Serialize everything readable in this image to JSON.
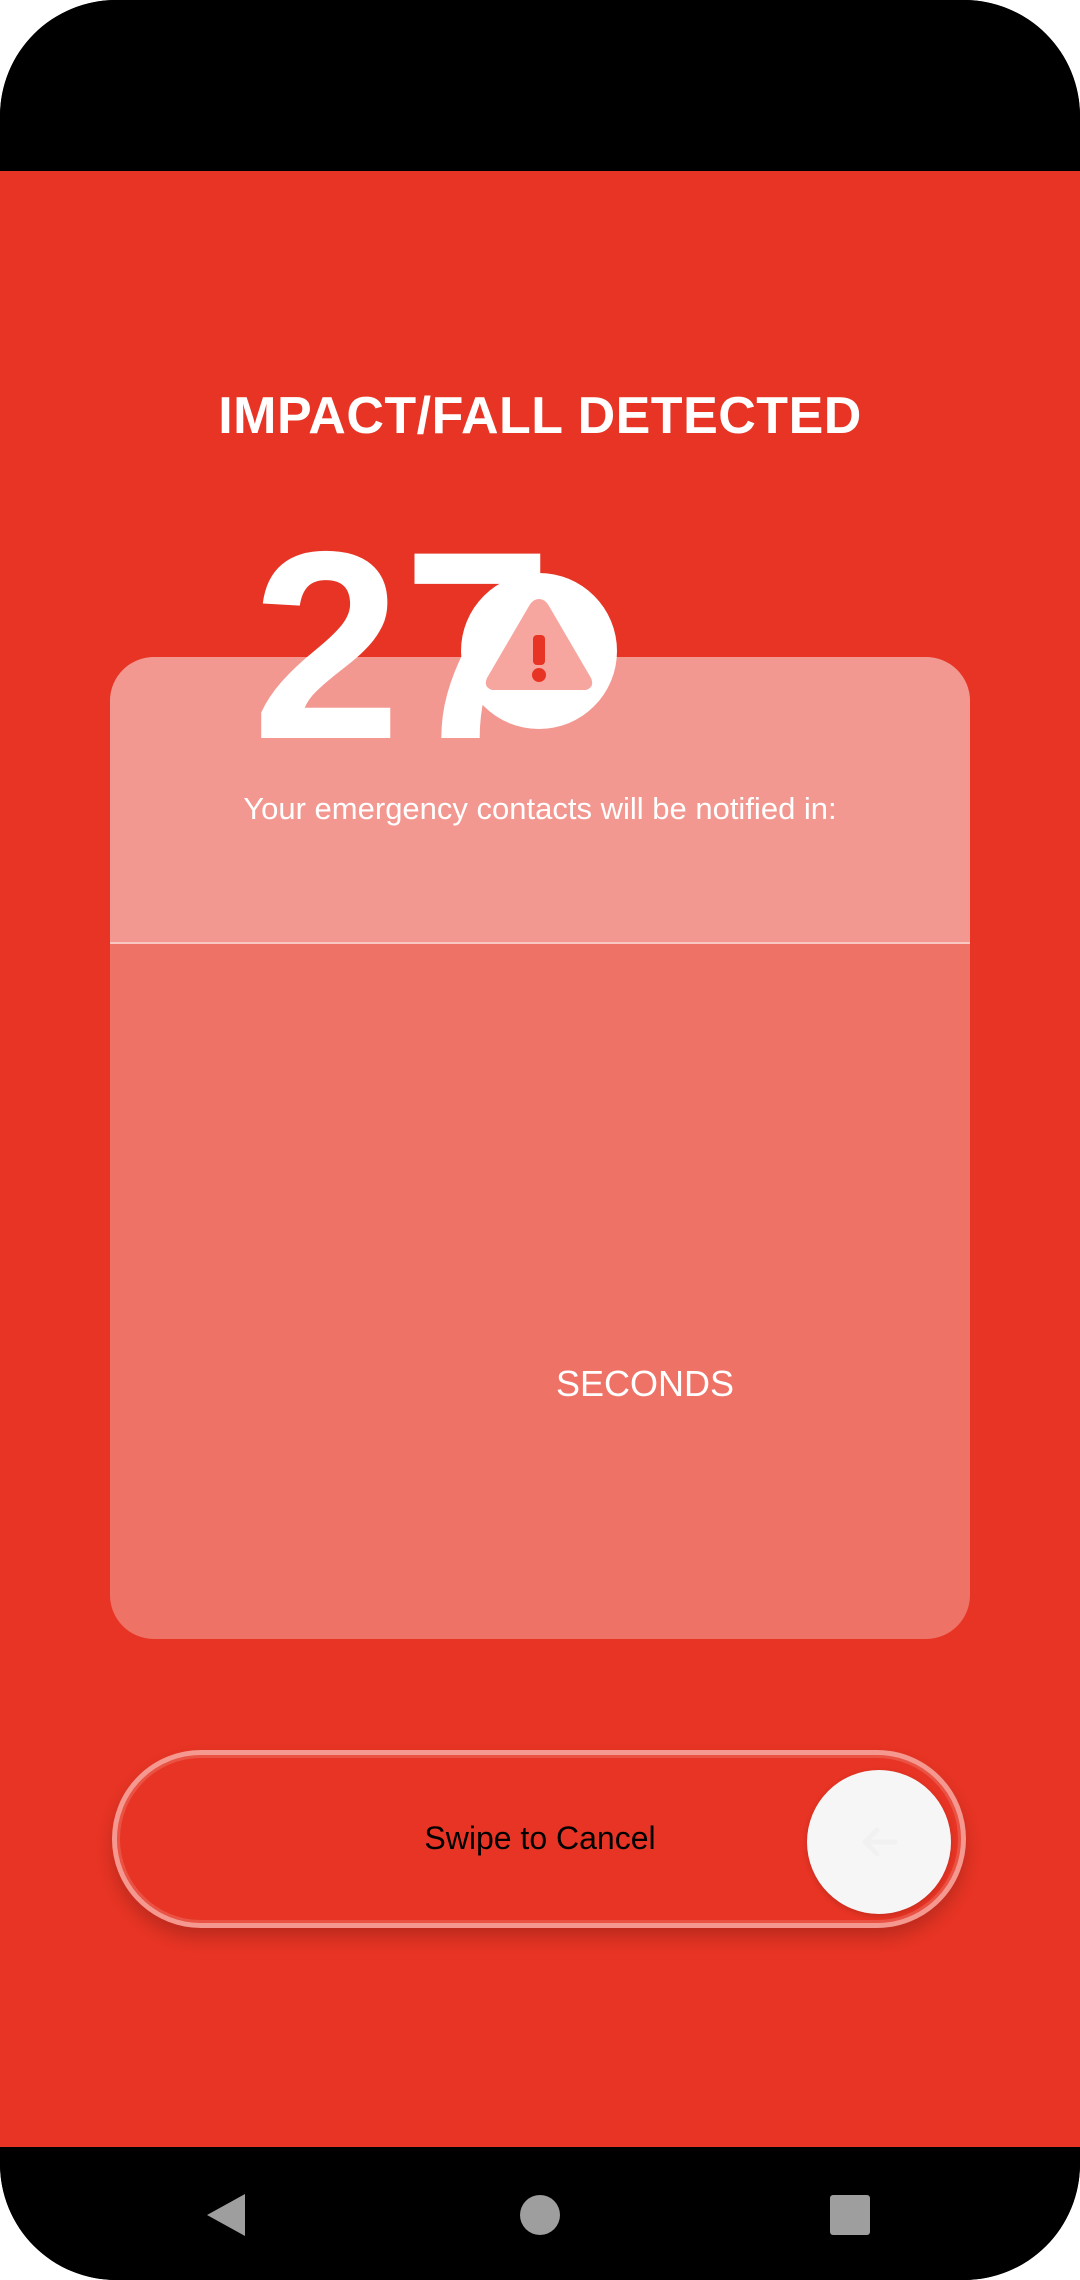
{
  "alert": {
    "title": "IMPACT/FALL DETECTED",
    "message": "Your emergency contacts will be notified in:",
    "countdown_value": "27",
    "countdown_unit": "SECONDS",
    "icon": "warning-triangle-icon"
  },
  "swipe": {
    "label": "Swipe to Cancel",
    "handle_icon": "arrow-left-icon"
  },
  "navigation": {
    "back_icon": "back-triangle-icon",
    "home_icon": "home-circle-icon",
    "recents_icon": "recents-square-icon"
  },
  "colors": {
    "background": "#E73424",
    "card_top": "#F29890",
    "card_bottom": "#EF7267",
    "text": "#FFFFFF",
    "system_bar": "#000000"
  }
}
